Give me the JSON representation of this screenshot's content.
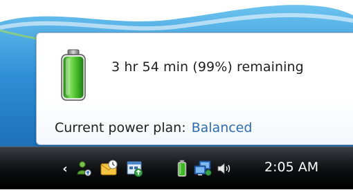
{
  "popup": {
    "remaining_text": "3 hr 54 min (99%) remaining",
    "battery_level_percent": 99,
    "plan_label": "Current power plan:",
    "plan_value": "Balanced"
  },
  "taskbar": {
    "clock": "2:05 AM",
    "tray_icons": [
      "show-hidden-icons-chevron",
      "user-sync-icon",
      "outlook-reminder-icon",
      "update-icon",
      "battery-icon",
      "network-icon",
      "volume-icon"
    ]
  },
  "colors": {
    "link": "#2a6db3",
    "battery_green": "#3fb624",
    "taskbar": "#0d0e10",
    "desktop_blue": "#2a82c9"
  }
}
